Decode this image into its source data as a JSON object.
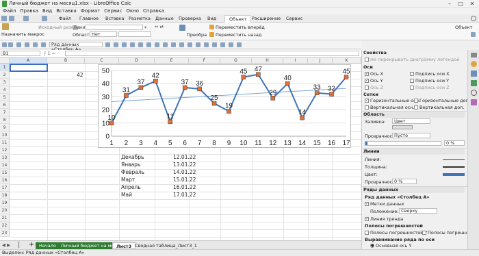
{
  "window": {
    "title": "Личный бюджет на месяц1.xlsx - LibreOffice Calc"
  },
  "menu": [
    "Файл",
    "Правка",
    "Вид",
    "Вставка",
    "Формат",
    "Сервис",
    "Окно",
    "Справка"
  ],
  "tabs": [
    "Файл",
    "Главное",
    "Вставка",
    "Разметка",
    "Данные",
    "Проверка",
    "Вид",
    "Объект",
    "Расширение",
    "Сервис"
  ],
  "active_tab": "Объект",
  "ribbon": {
    "macro": "Назначить макрос",
    "original_size": "Исходный размер",
    "line_label": "Линия",
    "area_label": "Область",
    "area_value": "Нет",
    "transform": "Преобра",
    "bring_forward": "Переместить вперёд",
    "send_backward": "Переместить назад",
    "object_label": "Объект"
  },
  "toolbar": {
    "chart_element": "Ряд данных «Столбец А»"
  },
  "formula": {
    "cell_ref": "B1"
  },
  "sheet": {
    "columns": [
      "A",
      "B",
      "C",
      "D",
      "E",
      "F",
      "G",
      "H",
      "I",
      "J",
      "K",
      "L",
      "M"
    ],
    "rows": [
      "1",
      "2",
      "3",
      "4",
      "5",
      "6",
      "7",
      "8",
      "9",
      "10",
      "11",
      "12",
      "13",
      "14",
      "15",
      "16",
      "17",
      "18",
      "19",
      "20",
      "21",
      "22",
      "23",
      "24"
    ],
    "c2_value": "42",
    "months": [
      "Декабрь",
      "Январь",
      "Февраль",
      "Март",
      "Апрель",
      "Май"
    ],
    "dates": [
      "12.01.22",
      "13.01.22",
      "14.01.22",
      "15.01.22",
      "16.01.22",
      "17.01.22"
    ]
  },
  "chart_data": {
    "type": "line",
    "x": [
      1,
      2,
      3,
      4,
      5,
      6,
      7,
      8,
      9,
      10,
      11,
      12,
      13,
      14,
      15,
      16,
      17
    ],
    "series": [
      {
        "values": [
          10,
          31,
          37,
          42,
          11,
          37,
          36,
          25,
          19,
          45,
          47,
          29,
          40,
          14,
          33,
          32,
          45
        ]
      }
    ],
    "ylim": [
      0,
      50
    ],
    "yticks": [
      0,
      10,
      20,
      30,
      40,
      50
    ],
    "trendline": true,
    "data_labels": true,
    "grid": true,
    "colors": {
      "line": "#3e74b7",
      "marker": "#e0703a",
      "trend": "#7aa7d6"
    }
  },
  "sheet_tabs": [
    "Начало",
    "Личный бюджет на месяц",
    "Лист3",
    "Сводная таблица_Лист3_1"
  ],
  "active_sheet": "Лист3",
  "status": "Выделен: Ряд данных «Столбец А»",
  "sidebar": {
    "properties": "Свойства",
    "no_overlap": "Не перекрывать диаграмму легендой",
    "axes": "Оси",
    "axis_x": "Ось X",
    "axis_y": "Ось Y",
    "axis_z": "Ось Z",
    "title_x": "Подпись оси X",
    "title_y": "Подпись оси Y",
    "title_z": "Подпись оси Z",
    "grids": "Сетки",
    "h_major": "Горизонтальные осн.",
    "h_minor": "Горизонтальные доп.",
    "v_major": "Вертикальная осн.",
    "v_minor": "Вертикальная доп.",
    "area": "Область",
    "fill_label": "Заливка:",
    "fill_value": "Цвет",
    "transparency_label": "Прозрачность:",
    "transparency_value": "Пусто",
    "transparency_pct": "0 %",
    "lines": "Линии",
    "line_label": "Линия:",
    "width_label": "Толщина:",
    "color_label": "Цвет:",
    "line_transp_label": "Прозрачность:",
    "line_transp_value": "0 %",
    "series_section": "Ряды данных",
    "series_name": "Ряд данных «Столбец А»",
    "data_labels": "Метки данных",
    "position_label": "Положение:",
    "position_value": "Сверху",
    "trendline": "Линия тренда",
    "error_bars": "Полосы погрешностей",
    "err_y_pos": "Полосы погрешностей Y",
    "err_y_neg": "Полосы погрешностей",
    "align": "Выравнивание ряда по оси",
    "primary_axis": "Основная ось Y"
  }
}
